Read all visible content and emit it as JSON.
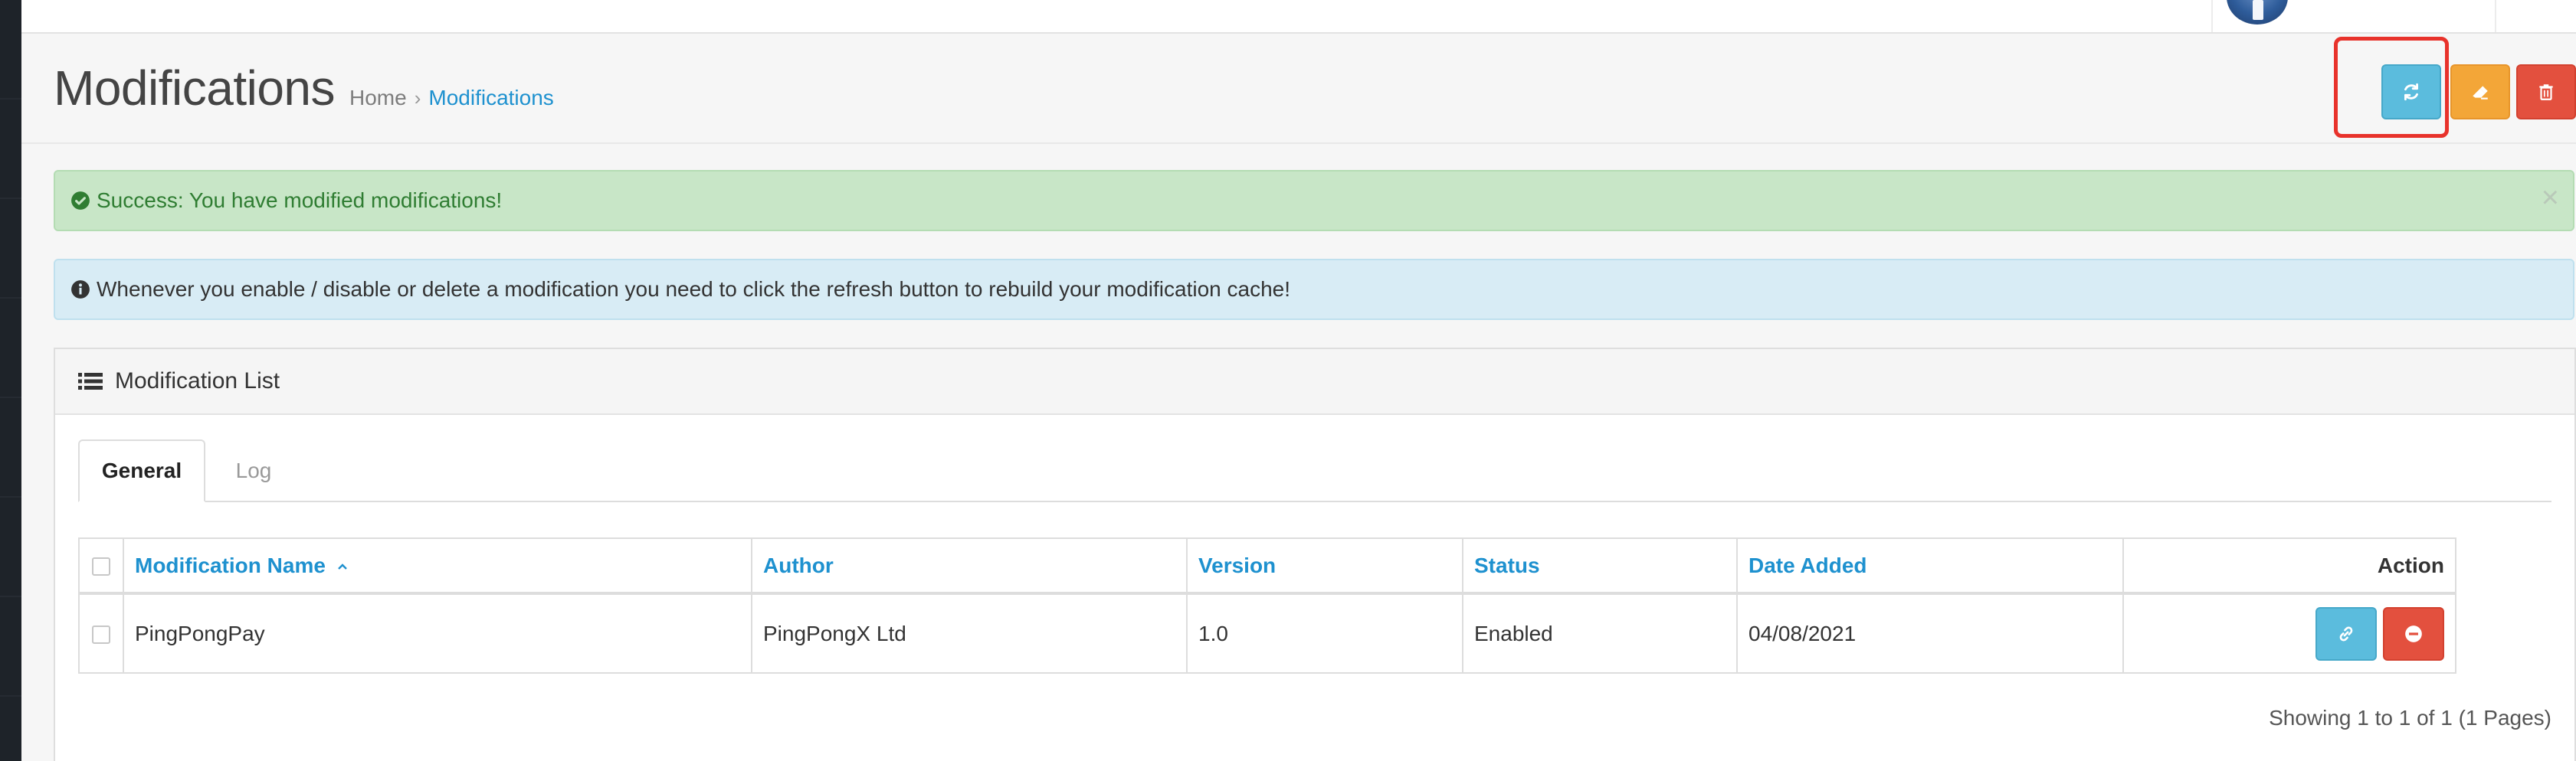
{
  "page": {
    "title": "Modifications",
    "breadcrumb": [
      "Home",
      "Modifications"
    ]
  },
  "toolbar": {
    "refresh_icon": "refresh-icon",
    "clear_icon": "eraser-icon",
    "delete_icon": "trash-icon",
    "colors": {
      "refresh": "#5bbcdd",
      "clear": "#f3a638",
      "delete": "#e3503e"
    }
  },
  "alerts": {
    "success": {
      "text": "Success: You have modified modifications!",
      "close": "×"
    },
    "info": {
      "text": "Whenever you enable / disable or delete a modification you need to click the refresh button to rebuild your modification cache!"
    }
  },
  "panel": {
    "title": "Modification List",
    "tabs": [
      {
        "label": "General",
        "active": true
      },
      {
        "label": "Log",
        "active": false
      }
    ]
  },
  "table": {
    "headers": {
      "name": "Modification Name",
      "author": "Author",
      "version": "Version",
      "status": "Status",
      "date_added": "Date Added",
      "action": "Action"
    },
    "rows": [
      {
        "name": "PingPongPay",
        "author": "PingPongX Ltd",
        "version": "1.0",
        "status": "Enabled",
        "date_added": "04/08/2021"
      }
    ]
  },
  "pagination": {
    "text": "Showing 1 to 1 of 1 (1 Pages)"
  }
}
